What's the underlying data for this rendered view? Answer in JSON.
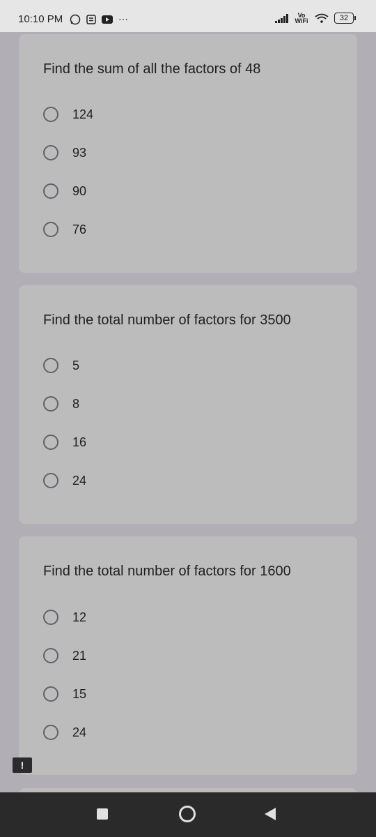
{
  "status_bar": {
    "time": "10:10 PM",
    "network": "Vo WiFi",
    "battery": "32"
  },
  "questions": [
    {
      "text": "Find the sum of all the factors of 48",
      "options": [
        "124",
        "93",
        "90",
        "76"
      ]
    },
    {
      "text": "Find the total number of factors for 3500",
      "options": [
        "5",
        "8",
        "16",
        "24"
      ]
    },
    {
      "text": "Find the total number of factors for 1600",
      "options": [
        "12",
        "21",
        "15",
        "24"
      ]
    }
  ],
  "report_badge": "!",
  "colors": {
    "page_background": "#b1aeb6",
    "card_background": "#bcbcbc",
    "radio_border": "#5f6368",
    "nav_bar": "#2a2a2a"
  }
}
